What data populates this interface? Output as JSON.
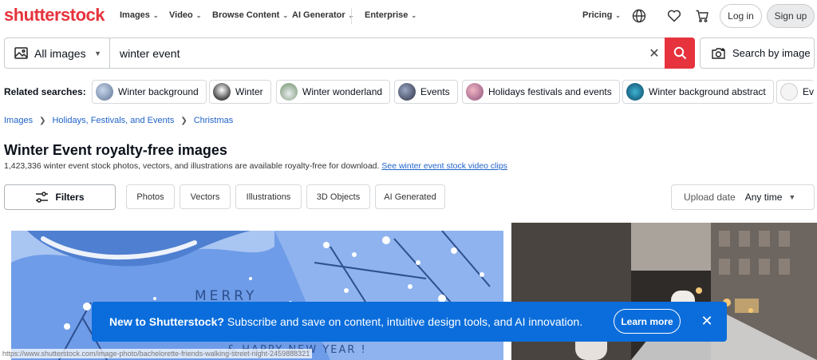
{
  "logo": "shutterstock",
  "nav": {
    "images": "Images",
    "video": "Video",
    "browse": "Browse Content",
    "ai": "AI Generator",
    "enterprise": "Enterprise",
    "pricing": "Pricing",
    "login": "Log in",
    "signup": "Sign up"
  },
  "search": {
    "type": "All images",
    "query": "winter event",
    "by_image": "Search by image"
  },
  "related": {
    "label": "Related searches:",
    "chips": [
      "Winter background",
      "Winter",
      "Winter wonderland",
      "Events",
      "Holidays festivals and events",
      "Winter background abstract",
      "Ev"
    ]
  },
  "breadcrumb": [
    "Images",
    "Holidays, Festivals, and Events",
    "Christmas"
  ],
  "title": "Winter Event royalty-free images",
  "subtitle": "1,423,336 winter event stock photos, vectors, and illustrations are available royalty-free for download.",
  "subtitle_link": "See winter event stock video clips",
  "filters": {
    "button": "Filters",
    "chips": [
      "Photos",
      "Vectors",
      "Illustrations",
      "3D Objects",
      "AI Generated"
    ],
    "upload_label": "Upload date",
    "upload_value": "Any time"
  },
  "card": {
    "line1": "MERRY",
    "line2": "& HAPPY NEW YEAR !"
  },
  "banner": {
    "bold": "New to Shutterstock?",
    "text": "Subscribe and save on content, intuitive design tools, and AI innovation.",
    "learn": "Learn more"
  },
  "status_url": "https://www.shutterstock.com/image-photo/bachelorette-friends-walking-street-night-2459888321"
}
